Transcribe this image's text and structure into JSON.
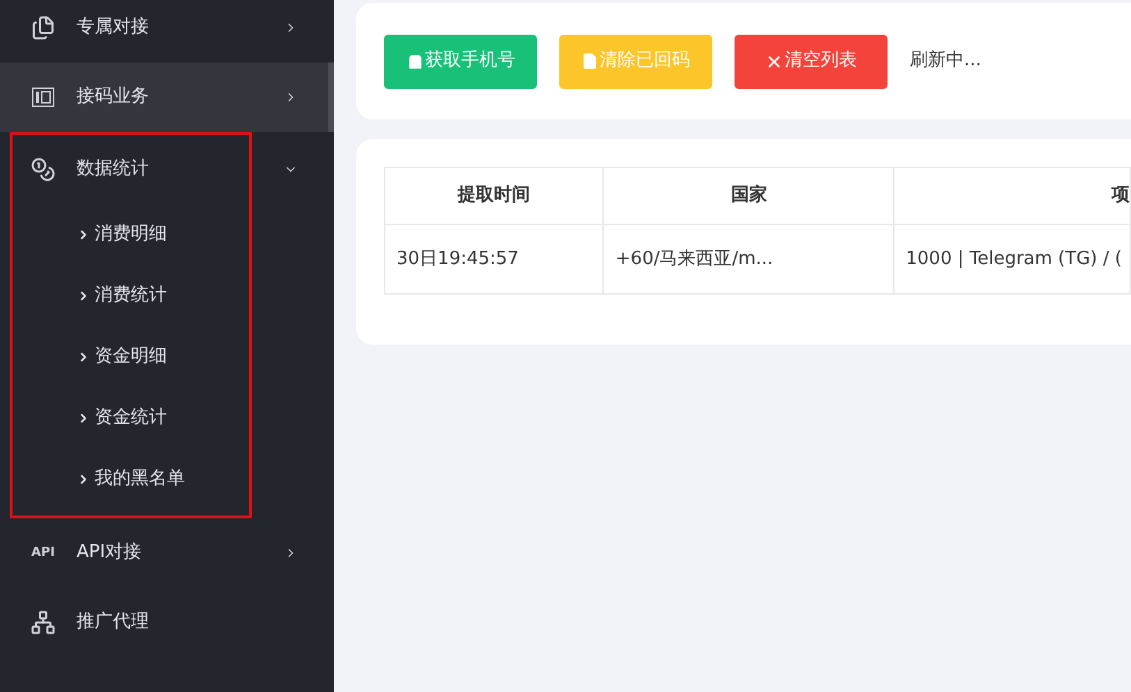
{
  "sidebar": {
    "items": [
      {
        "label": "专属对接",
        "kind": "files",
        "selected": false,
        "expanded": false,
        "highlighted": false
      },
      {
        "label": "接码业务",
        "kind": "counter",
        "selected": true,
        "expanded": false,
        "highlighted": false
      },
      {
        "label": "数据统计",
        "kind": "coins",
        "selected": false,
        "expanded": true,
        "highlighted": true,
        "children": [
          {
            "label": "消费明细"
          },
          {
            "label": "消费统计"
          },
          {
            "label": "资金明细"
          },
          {
            "label": "资金统计"
          },
          {
            "label": "我的黑名单"
          }
        ]
      },
      {
        "label": "API对接",
        "kind": "api",
        "icon_text": "API",
        "selected": false,
        "expanded": false,
        "highlighted": false
      },
      {
        "label": "推广代理",
        "kind": "network",
        "selected": false,
        "highlighted": false
      }
    ]
  },
  "toolbar": {
    "buttons": [
      {
        "label": "获取手机号",
        "kind": "get"
      },
      {
        "label": "清除已回码",
        "kind": "clear-done"
      },
      {
        "label": "清空列表",
        "kind": "clear-all"
      }
    ],
    "status": "刷新中..."
  },
  "table": {
    "columns": [
      "提取时间",
      "国家",
      "项"
    ],
    "rows": [
      [
        "30日19:45:57",
        "+60/马来西亚/m...",
        "1000 | Telegram (TG) / ("
      ]
    ]
  }
}
